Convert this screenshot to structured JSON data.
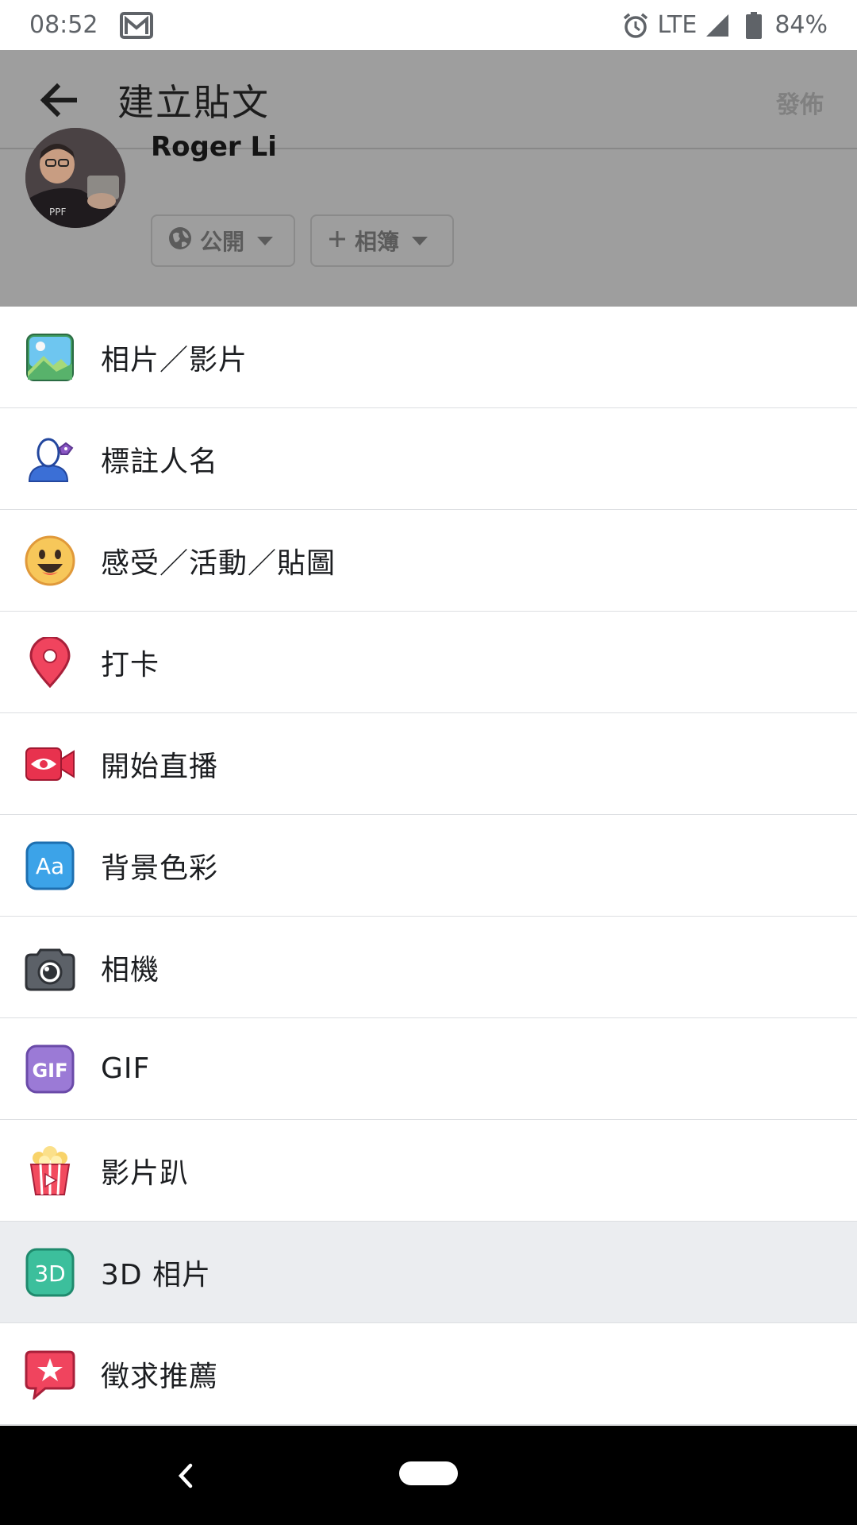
{
  "status_bar": {
    "time": "08:52",
    "network": "LTE",
    "battery": "84%",
    "icons": [
      "gmail-icon",
      "alarm-icon",
      "signal-icon",
      "battery-icon"
    ]
  },
  "header": {
    "title": "建立貼文",
    "publish_label": "發佈"
  },
  "composer": {
    "user_name": "Roger Li",
    "privacy_label": "公開",
    "album_label": "相簿"
  },
  "options": [
    {
      "label": "相片／影片",
      "icon": "photo-video-icon"
    },
    {
      "label": "標註人名",
      "icon": "tag-people-icon"
    },
    {
      "label": "感受／活動／貼圖",
      "icon": "feeling-icon"
    },
    {
      "label": "打卡",
      "icon": "check-in-icon"
    },
    {
      "label": "開始直播",
      "icon": "live-video-icon"
    },
    {
      "label": "背景色彩",
      "icon": "background-color-icon"
    },
    {
      "label": "相機",
      "icon": "camera-icon"
    },
    {
      "label": "GIF",
      "icon": "gif-icon"
    },
    {
      "label": "影片趴",
      "icon": "watch-party-icon"
    },
    {
      "label": "3D 相片",
      "icon": "3d-photo-icon"
    },
    {
      "label": "徵求推薦",
      "icon": "ask-recommendations-icon"
    }
  ],
  "colors": {
    "dim_overlay": "#9e9e9e",
    "highlight_row": "#ebedf0",
    "divider": "#dddfe2",
    "text": "#1c1e21"
  }
}
